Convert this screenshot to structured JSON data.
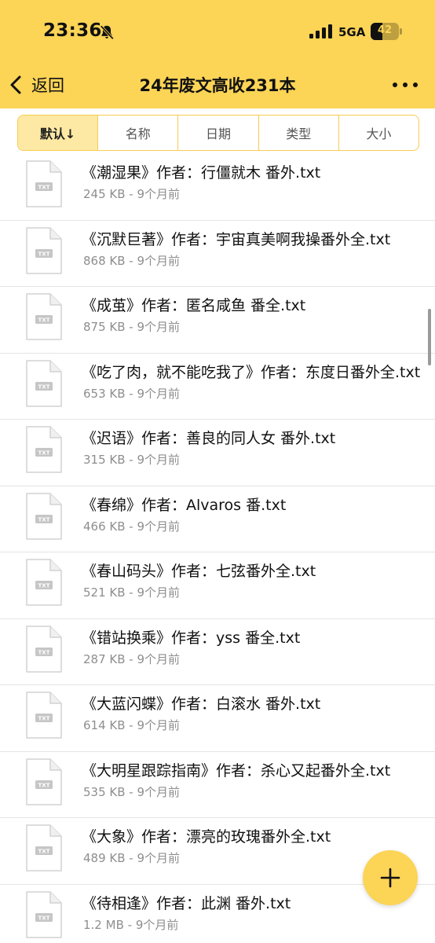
{
  "status_bar": {
    "time": "23:36",
    "network": "5GA",
    "battery_level": "42",
    "icons": [
      "bell-slash-icon",
      "signal-icon",
      "battery-icon"
    ]
  },
  "nav": {
    "back_label": "返回",
    "title": "24年废文高收231本",
    "back_icon": "chevron-left-icon",
    "more_icon": "more-icon"
  },
  "sort_tabs": [
    {
      "label": "默认↓",
      "active": true
    },
    {
      "label": "名称",
      "active": false
    },
    {
      "label": "日期",
      "active": false
    },
    {
      "label": "类型",
      "active": false
    },
    {
      "label": "大小",
      "active": false
    }
  ],
  "file_icon_label": "TXT",
  "files": [
    {
      "name": "《潮湿果》作者：行僵就木 番外.txt",
      "size": "245 KB",
      "date": "9个月前"
    },
    {
      "name": "《沉默巨著》作者：宇宙真美啊我操番外全.txt",
      "size": "868 KB",
      "date": "9个月前"
    },
    {
      "name": "《成茧》作者：匿名咸鱼 番全.txt",
      "size": "875 KB",
      "date": "9个月前"
    },
    {
      "name": "《吃了肉，就不能吃我了》作者：东度日番外全.txt",
      "size": "653 KB",
      "date": "9个月前"
    },
    {
      "name": "《迟语》作者：善良的同人女 番外.txt",
      "size": "315 KB",
      "date": "9个月前"
    },
    {
      "name": "《春绵》作者：Alvaros 番.txt",
      "size": "466 KB",
      "date": "9个月前"
    },
    {
      "name": "《春山码头》作者：七弦番外全.txt",
      "size": "521 KB",
      "date": "9个月前"
    },
    {
      "name": "《错站换乘》作者：yss 番全.txt",
      "size": "287 KB",
      "date": "9个月前"
    },
    {
      "name": "《大蓝闪蝶》作者：白滚水 番外.txt",
      "size": "614 KB",
      "date": "9个月前"
    },
    {
      "name": "《大明星跟踪指南》作者：杀心又起番外全.txt",
      "size": "535 KB",
      "date": "9个月前"
    },
    {
      "name": "《大象》作者：漂亮的玫瑰番外全.txt",
      "size": "489 KB",
      "date": "9个月前"
    },
    {
      "name": "《待相逢》作者：此渊 番外.txt",
      "size": "1.2 MB",
      "date": "9个月前"
    }
  ],
  "fab": {
    "icon": "plus-icon"
  },
  "colors": {
    "accent": "#fcd456",
    "active_tab_bg": "#fde9a3",
    "meta_text": "#8e8e8e",
    "divider": "#e4e4e4"
  }
}
